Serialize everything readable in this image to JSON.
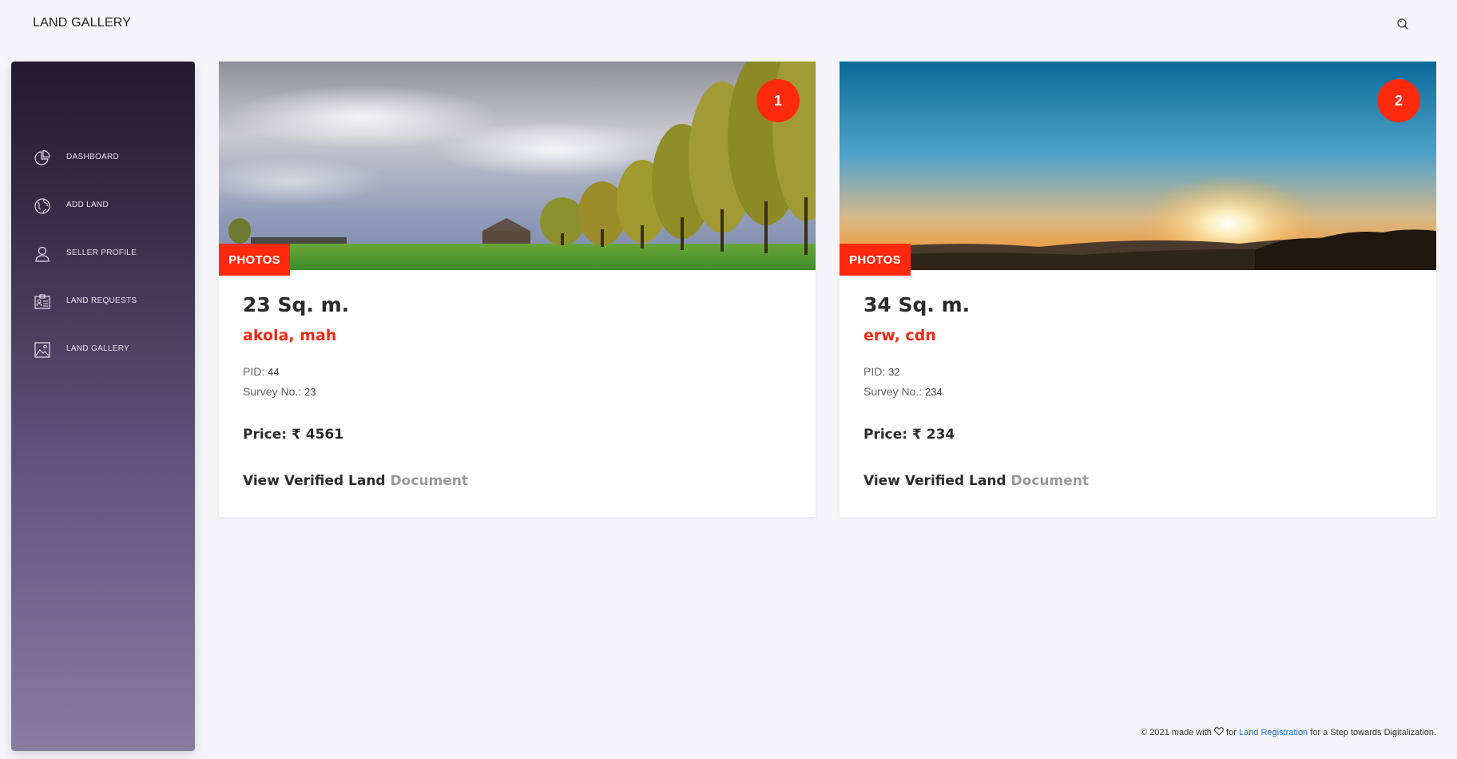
{
  "header": {
    "title": "LAND GALLERY"
  },
  "sidebar": {
    "items": [
      {
        "label": "DASHBOARD",
        "icon": "pie-chart-icon"
      },
      {
        "label": "ADD LAND",
        "icon": "globe-icon"
      },
      {
        "label": "SELLER PROFILE",
        "icon": "user-icon"
      },
      {
        "label": "LAND REQUESTS",
        "icon": "id-card-icon"
      },
      {
        "label": "LAND GALLERY",
        "icon": "image-icon"
      }
    ]
  },
  "cards": [
    {
      "number": "1",
      "photos_label": "PHOTOS",
      "area": "23 Sq. m.",
      "location": "akola, mah",
      "pid_label": "PID:",
      "pid": "44",
      "survey_label": "Survey No.:",
      "survey": "23",
      "price": "Price: ₹ 4561",
      "doc_text": "View Verified Land",
      "doc_link": "Document"
    },
    {
      "number": "2",
      "photos_label": "PHOTOS",
      "area": "34 Sq. m.",
      "location": "erw, cdn",
      "pid_label": "PID:",
      "pid": "32",
      "survey_label": "Survey No.:",
      "survey": "234",
      "price": "Price: ₹ 234",
      "doc_text": "View Verified Land",
      "doc_link": "Document"
    }
  ],
  "footer": {
    "prefix": "© 2021 made with",
    "middle": "for",
    "link": "Land Registration",
    "suffix": "for a Step towards Digitalization."
  },
  "colors": {
    "accent": "#ff2a0e",
    "location": "#ee2a18",
    "footer_link": "#1a6fd6"
  }
}
